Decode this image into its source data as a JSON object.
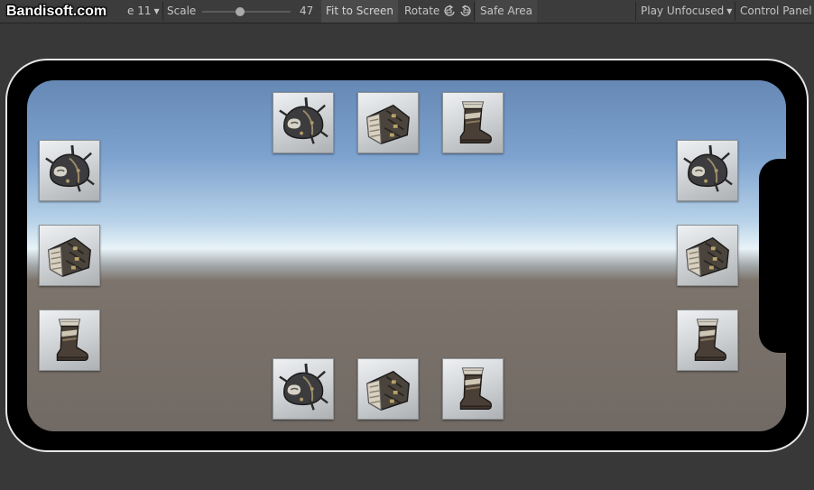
{
  "toolbar": {
    "watermark": "Bandisoft.com",
    "device_partial": "e 11",
    "scale_label": "Scale",
    "scale_value": "47",
    "fit_to_screen": "Fit to Screen",
    "rotate": "Rotate",
    "safe_area": "Safe Area",
    "play_mode": "Play Unfocused",
    "control_panel": "Control Panel"
  },
  "scene": {
    "top_row": [
      {
        "icon": "spiked-helmet-icon"
      },
      {
        "icon": "gauntlet-icon"
      },
      {
        "icon": "boot-icon"
      }
    ],
    "bottom_row": [
      {
        "icon": "spiked-helmet-icon"
      },
      {
        "icon": "gauntlet-icon"
      },
      {
        "icon": "boot-icon"
      }
    ],
    "left_column": [
      {
        "icon": "spiked-helmet-icon"
      },
      {
        "icon": "gauntlet-icon"
      },
      {
        "icon": "boot-icon"
      }
    ],
    "right_column": [
      {
        "icon": "spiked-helmet-icon"
      },
      {
        "icon": "gauntlet-icon"
      },
      {
        "icon": "boot-icon"
      }
    ]
  }
}
